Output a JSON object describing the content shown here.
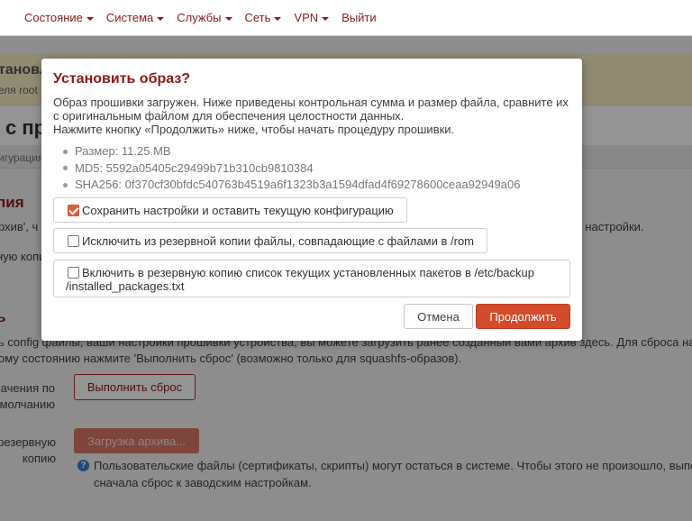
{
  "nav": {
    "items": [
      {
        "label": "Состояние",
        "dropdown": true
      },
      {
        "label": "Система",
        "dropdown": true
      },
      {
        "label": "Службы",
        "dropdown": true
      },
      {
        "label": "Сеть",
        "dropdown": true
      },
      {
        "label": "VPN",
        "dropdown": true
      },
      {
        "label": "Выйти",
        "dropdown": false
      }
    ]
  },
  "background": {
    "alert_title": "тановл",
    "alert_sub": "еля root",
    "page_title": "с пр",
    "tab_text": "игурация",
    "section1_title": "пия",
    "section1_text": "рхив', ч",
    "section1_text_right": "е его настройки.",
    "section1_label": "ную копи",
    "section2_title": "ь",
    "section2_line1": "ь config файлы, ваши настройки прошивки устройства, вы можете загрузить ранее созданный вами архив здесь. Для сброса на",
    "section2_line2": "ому состоянию нажмите 'Выполнить сброс' (возможно только для squashfs-образов).",
    "reset_label_1": "начения по",
    "reset_label_2": "молчанию",
    "reset_button": "Выполнить сброс",
    "backup_label_1": "резервную",
    "backup_label_2": "копию",
    "upload_button": "Загрузка архива...",
    "info_icon": "?",
    "info_line1": "Пользовательские файлы (сертификаты, скрипты) могут остаться в системе. Чтобы этого не произошло, выпо",
    "info_line2": "сначала сброс к заводским настройкам."
  },
  "modal": {
    "title": "Установить образ?",
    "desc_line1": "Образ прошивки загружен. Ниже приведены контрольная сумма и размер файла, сравните их",
    "desc_line2": "с оригинальным файлом для обеспечения целостности данных.",
    "desc_line3": "Нажмите кнопку «Продолжить» ниже, чтобы начать процедуру прошивки.",
    "size": "Размер: 11.25 MB",
    "md5": "MD5: 5592a05405c29499b71b310cb9810384",
    "sha256": "SHA256: 0f370cf30bfdc540763b4519a6f1323b3a1594dfad4f69278600ceaa92949a06",
    "option_keep": {
      "label": "Сохранить настройки и оставить текущую конфигурацию",
      "checked": true
    },
    "option_exclude": {
      "label": "Исключить из резервной копии файлы, совпадающие с файлами в /rom",
      "checked": false
    },
    "option_packages": {
      "label_line1": "Включить в резервную копию список текущих установленных пакетов в /etc/backup",
      "label_line2": "/installed_packages.txt",
      "checked": false
    },
    "cancel_label": "Отмена",
    "continue_label": "Продолжить"
  },
  "colors": {
    "accent": "#8b1a1a",
    "primary_button": "#d24c2c",
    "checkbox_checked": "#e0603c"
  }
}
